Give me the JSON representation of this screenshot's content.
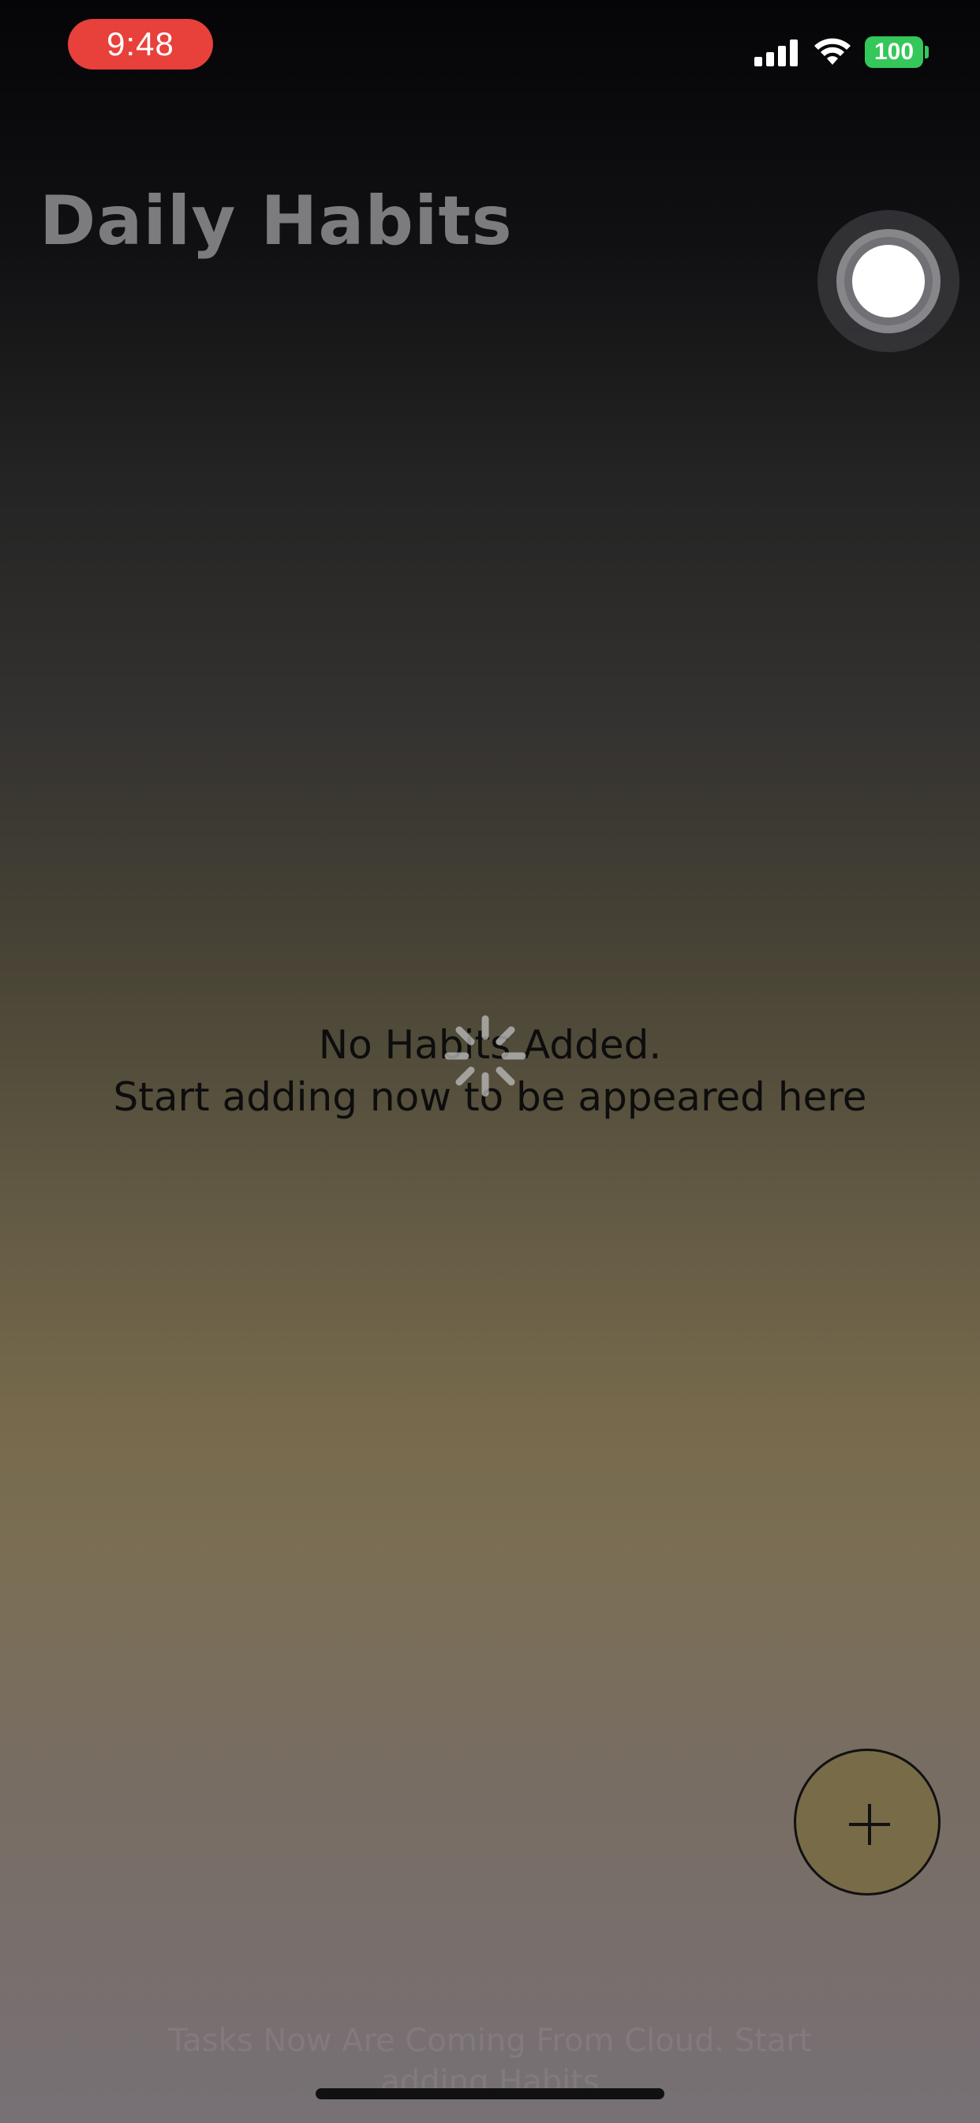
{
  "status_bar": {
    "time": "9:48",
    "battery": "100",
    "icons": [
      "signal-icon",
      "wifi-icon",
      "battery-icon"
    ],
    "time_pill_color": "#e8403a",
    "battery_color": "#34c759"
  },
  "header": {
    "title": "Daily Habits"
  },
  "empty_state": {
    "line1": "No Habits Added.",
    "line2": "Start adding now to be appeared here"
  },
  "fab": {
    "icon": "plus-icon",
    "color": "#786b48"
  },
  "footer": {
    "hint_line1": "Tasks Now Are Coming From Cloud. Start",
    "hint_line2": "adding Habits"
  }
}
